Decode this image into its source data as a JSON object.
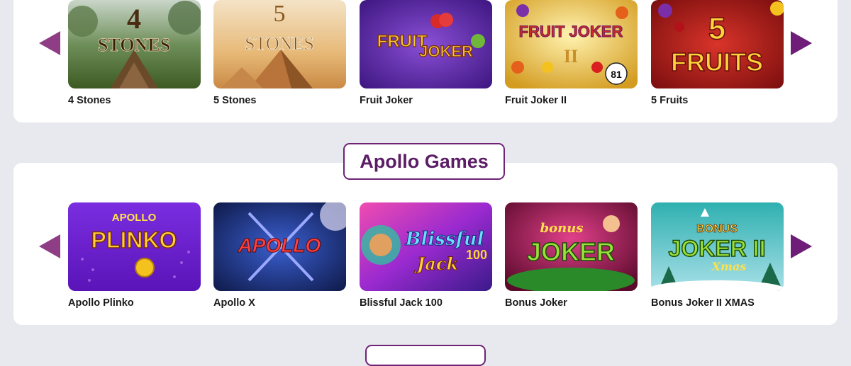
{
  "sections": [
    {
      "title": "",
      "games": [
        {
          "name": "4 Stones",
          "art": "4 STONES"
        },
        {
          "name": "5 Stones",
          "art": "5 STONES"
        },
        {
          "name": "Fruit Joker",
          "art": "FRUIT JOKER"
        },
        {
          "name": "Fruit Joker II",
          "art": "FRUIT JOKER II"
        },
        {
          "name": "5 Fruits",
          "art": "5 FRUITS"
        }
      ]
    },
    {
      "title": "Apollo Games",
      "games": [
        {
          "name": "Apollo Plinko",
          "art": "APOLLO PLINKO"
        },
        {
          "name": "Apollo X",
          "art": "APOLLO"
        },
        {
          "name": "Blissful Jack 100",
          "art": "Blissful Jack 100"
        },
        {
          "name": "Bonus Joker",
          "art": "bonus JOKER"
        },
        {
          "name": "Bonus Joker II XMAS",
          "art": "BONUS JOKER II Xmas"
        }
      ]
    }
  ],
  "controls": {
    "prev_icon": "chevron-left-icon",
    "next_icon": "chevron-right-icon"
  },
  "colors": {
    "accent": "#6e1e78",
    "title_text": "#5b1d66",
    "background": "#e8e9ee",
    "panel": "#ffffff"
  }
}
